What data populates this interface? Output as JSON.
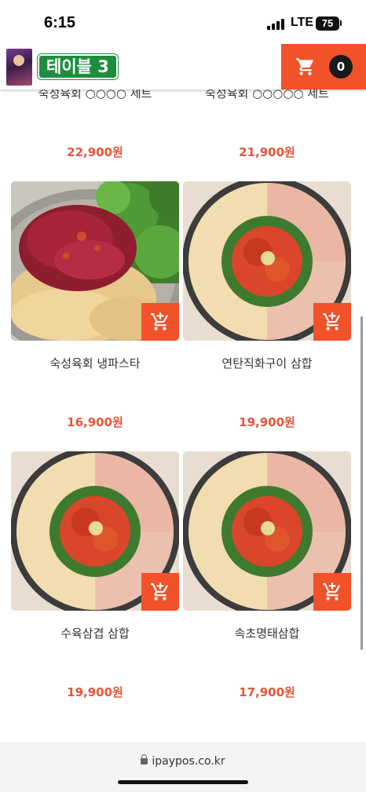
{
  "status_bar": {
    "time": "6:15",
    "network": "LTE",
    "battery": "75"
  },
  "header": {
    "table_label": "테이블 3",
    "cart_count": "0",
    "accent_color": "#f1522a",
    "badge_color": "#1e8e3e"
  },
  "menu": {
    "partial_row": [
      {
        "name": "숙성육회 ○○○○ 세트",
        "price": "22,900원"
      },
      {
        "name": "숙성육회 ○○○○○ 세트",
        "price": "21,900원"
      }
    ],
    "items": [
      {
        "name": "숙성육회 냉파스타",
        "price": "16,900원",
        "image": "raw-beef-pasta-photo"
      },
      {
        "name": "연탄직화구이 삼합",
        "price": "19,900원",
        "image": "grilled-samhap-photo"
      },
      {
        "name": "수육삼겹 삼합",
        "price": "19,900원",
        "image": "pork-samhap-photo"
      },
      {
        "name": "속초명태삼합",
        "price": "17,900원",
        "image": "pollock-samhap-photo"
      }
    ],
    "price_color": "#e8553a"
  },
  "browser": {
    "url": "ipaypos.co.kr"
  }
}
